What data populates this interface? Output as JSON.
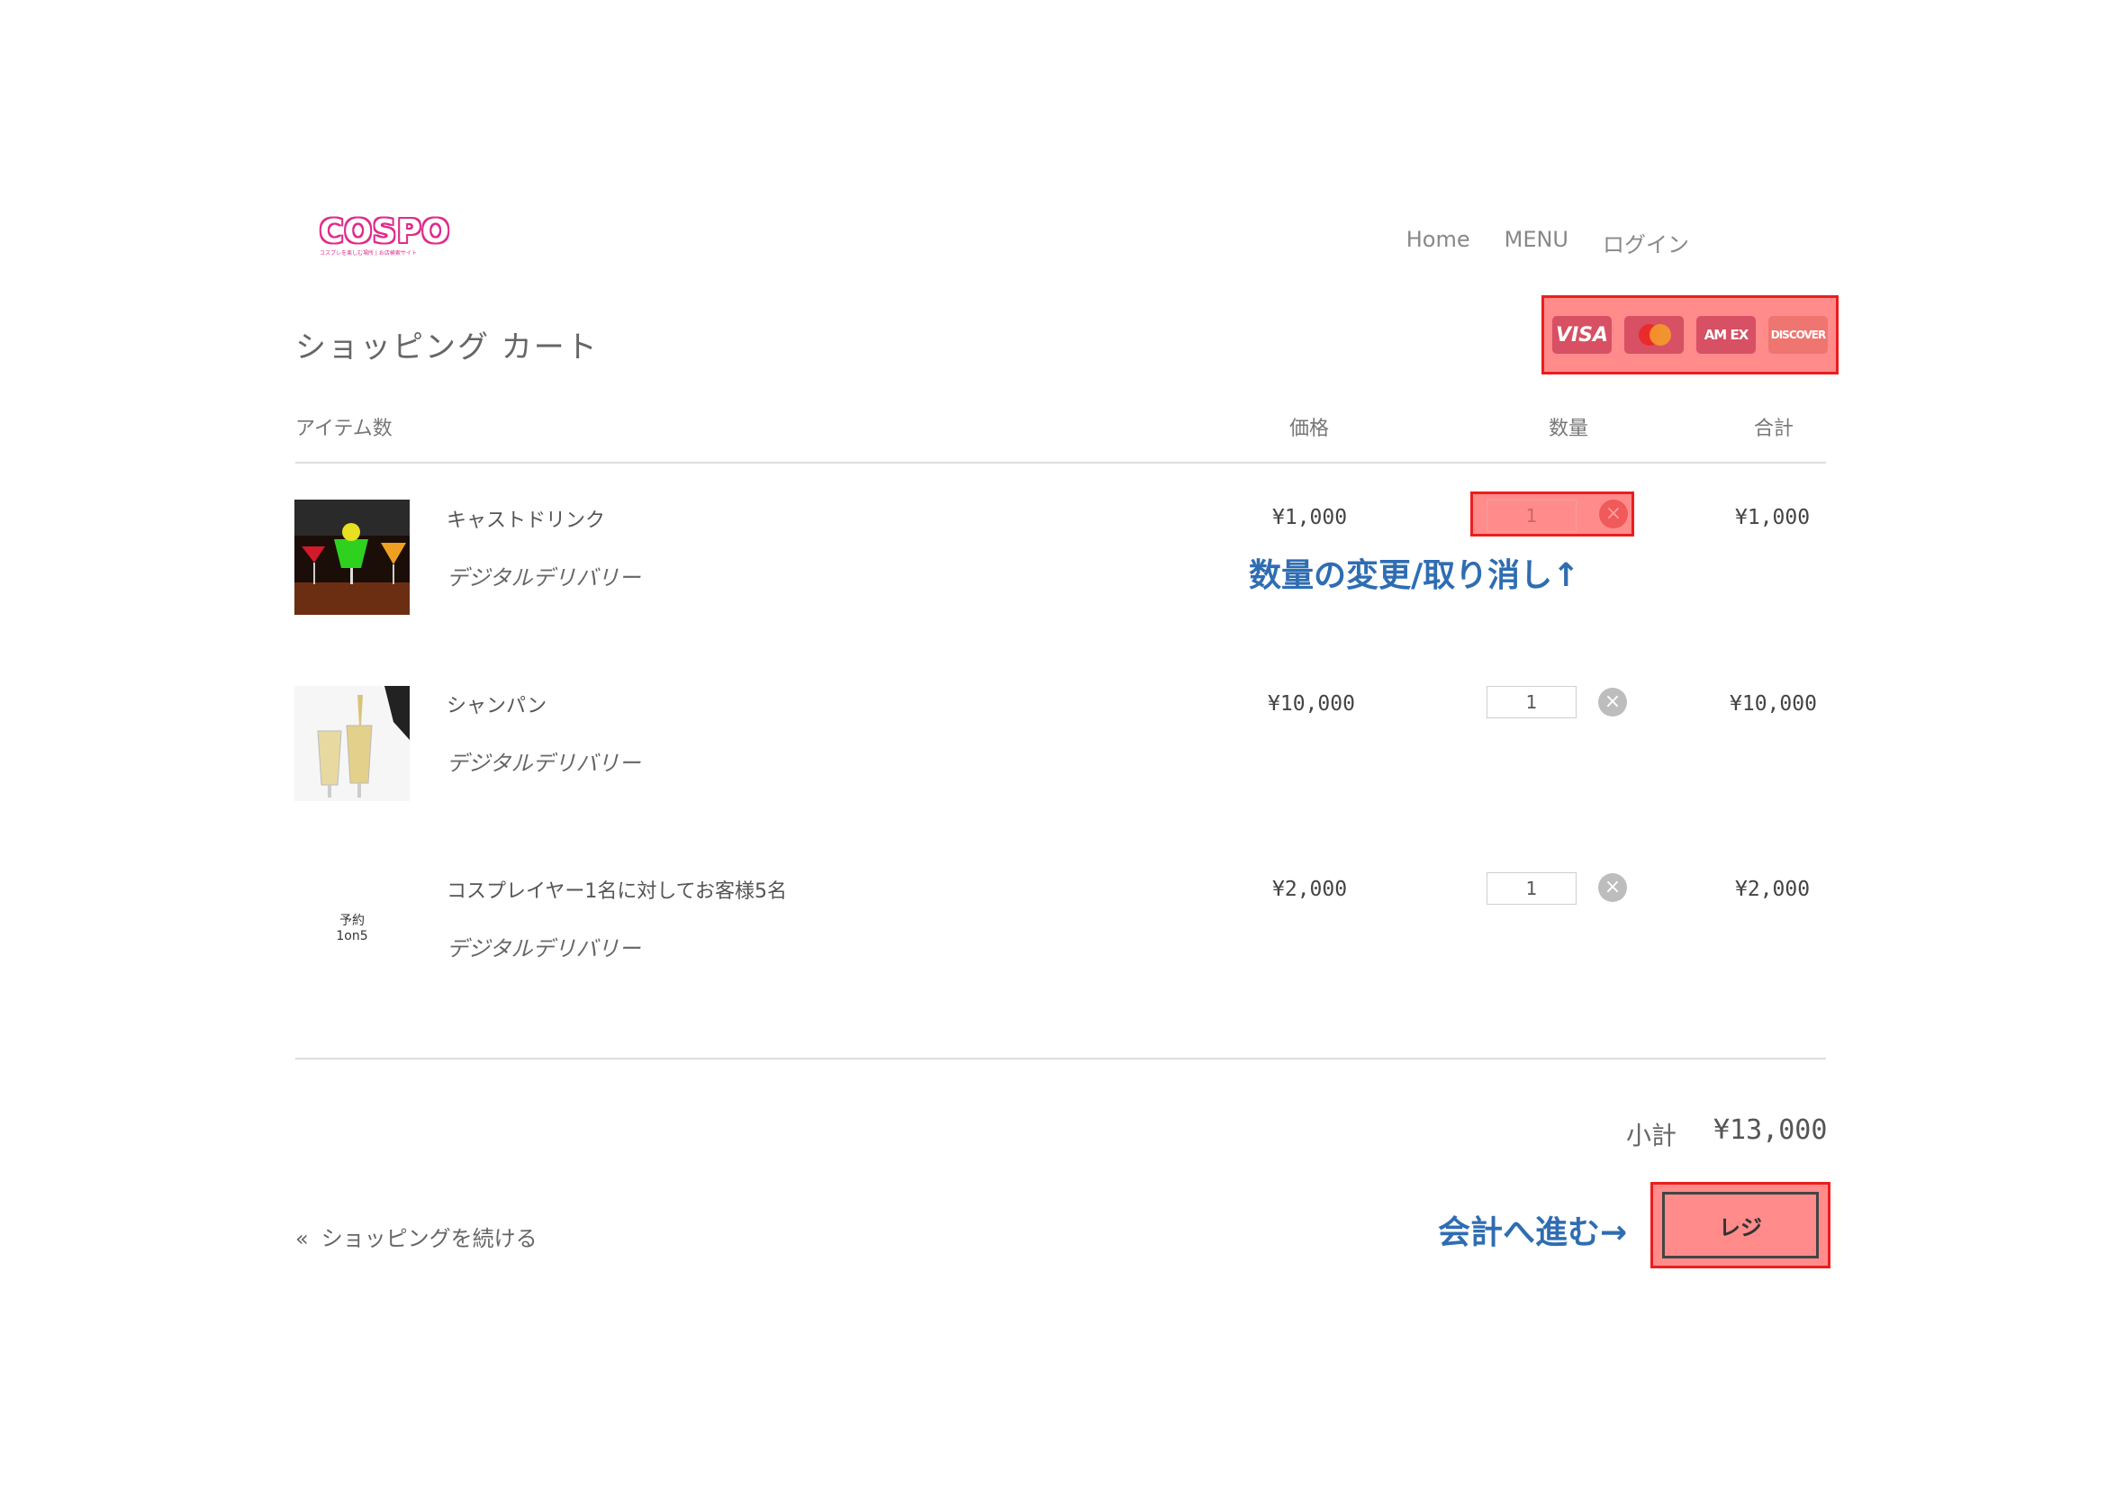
{
  "brand": {
    "logo_text": "COSPO",
    "logo_tagline": "コスプレを楽しむ場所 | お店検索サイト"
  },
  "nav": {
    "items": [
      "Home",
      "MENU",
      "ログイン"
    ]
  },
  "page": {
    "title": "ショッピング カート"
  },
  "payment_icons": [
    {
      "name": "visa-icon",
      "label": "VISA"
    },
    {
      "name": "mastercard-icon",
      "label": ""
    },
    {
      "name": "amex-icon",
      "label": "AM EX"
    },
    {
      "name": "discover-icon",
      "label": "DISCOVER"
    }
  ],
  "table": {
    "headers": {
      "items": "アイテム数",
      "price": "価格",
      "qty": "数量",
      "total": "合計"
    }
  },
  "cart_items": [
    {
      "name": "キャストドリンク",
      "delivery": "デジタルデリバリー",
      "price": "¥1,000",
      "qty": "1",
      "total": "¥1,000"
    },
    {
      "name": "シャンパン",
      "delivery": "デジタルデリバリー",
      "price": "¥10,000",
      "qty": "1",
      "total": "¥10,000"
    },
    {
      "name": "コスプレイヤー1名に対してお客様5名",
      "delivery": "デジタルデリバリー",
      "price": "¥2,000",
      "qty": "1",
      "total": "¥2,000",
      "thumb_text_1": "予約",
      "thumb_text_2": "1on5"
    }
  ],
  "annotations": {
    "qty_note": "数量の変更/取り消し↑",
    "checkout_note": "会計へ進む→"
  },
  "summary": {
    "subtotal_label": "小計",
    "subtotal_value": "¥13,000"
  },
  "footer": {
    "continue_shopping": "ショッピングを続ける",
    "continue_prefix": "«",
    "checkout_label": "レジ"
  },
  "colors": {
    "highlight_fill": "#ff8b8b",
    "highlight_border": "#ee1d1d",
    "annotation": "#2f6db2",
    "brand": "#e02b8a"
  }
}
